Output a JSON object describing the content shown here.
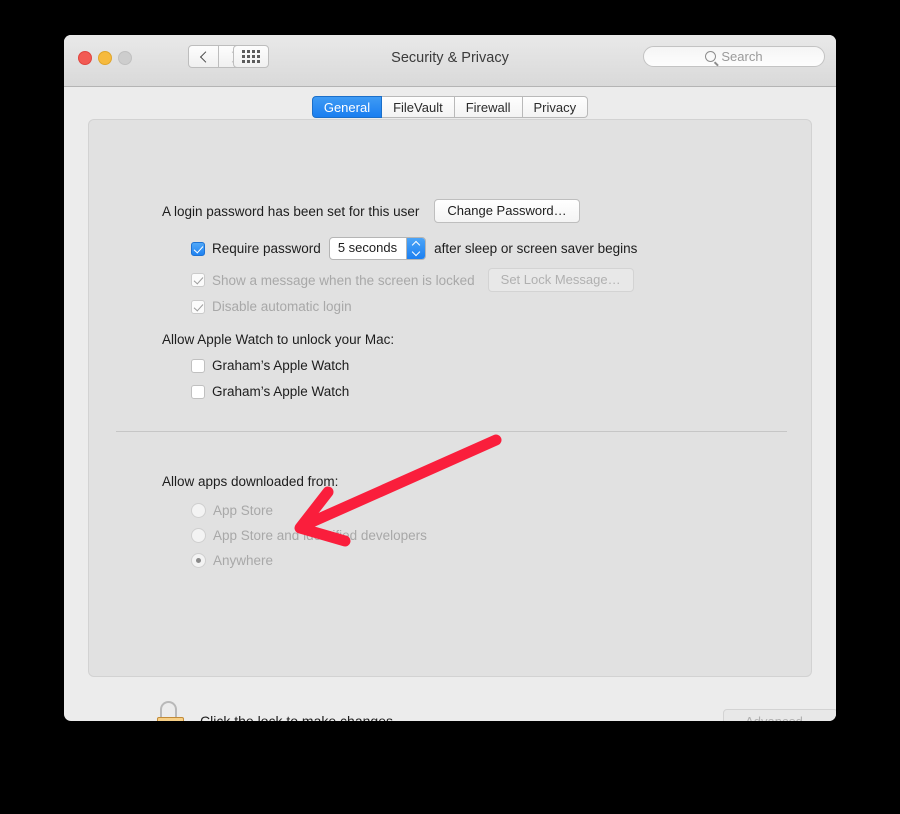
{
  "window": {
    "title": "Security & Privacy",
    "traffic_lights": [
      "close",
      "minimize",
      "zoom"
    ],
    "nav": {
      "back": "back-arrow",
      "forward": "forward-arrow",
      "grid": "show-all-grid"
    },
    "search": {
      "placeholder": "Search",
      "value": "",
      "icon": "search-icon"
    }
  },
  "tabs": [
    {
      "label": "General",
      "selected": true
    },
    {
      "label": "FileVault",
      "selected": false
    },
    {
      "label": "Firewall",
      "selected": false
    },
    {
      "label": "Privacy",
      "selected": false
    }
  ],
  "general": {
    "login_password_text": "A login password has been set for this user",
    "change_password_button": "Change Password…",
    "require_password": {
      "label": "Require password",
      "checked": true,
      "delay_value": "5 seconds",
      "suffix": "after sleep or screen saver begins"
    },
    "show_message": {
      "label": "Show a message when the screen is locked",
      "checked": true,
      "enabled": false,
      "button": "Set Lock Message…"
    },
    "disable_auto_login": {
      "label": "Disable automatic login",
      "checked": true,
      "enabled": false
    },
    "apple_watch": {
      "heading": "Allow Apple Watch to unlock your Mac:",
      "items": [
        {
          "label": "Graham’s Apple Watch",
          "checked": false
        },
        {
          "label": "Graham’s Apple Watch",
          "checked": false
        }
      ]
    },
    "downloads": {
      "heading": "Allow apps downloaded from:",
      "options": [
        {
          "label": "App Store",
          "selected": false
        },
        {
          "label": "App Store and identified developers",
          "selected": false
        },
        {
          "label": "Anywhere",
          "selected": true
        }
      ],
      "enabled": false
    }
  },
  "footer": {
    "lock_icon": "unlocked-padlock-icon",
    "lock_text": "Click the lock to make changes.",
    "advanced_button": "Advanced…",
    "advanced_enabled": false,
    "help_button": "?"
  },
  "annotation": {
    "type": "arrow",
    "color": "#FA1E3C",
    "points_to": "Anywhere"
  },
  "colors": {
    "accent_blue": "#1A7EF0",
    "window_bg": "#ECECEC",
    "panel_bg": "#E1E1E1",
    "annotation_red": "#FA1E3C"
  }
}
